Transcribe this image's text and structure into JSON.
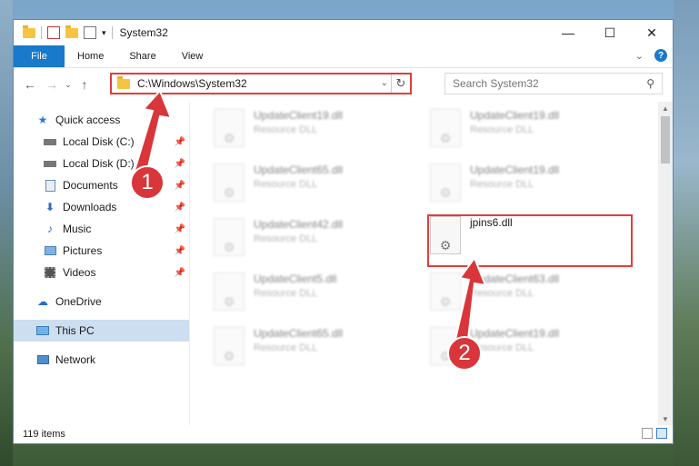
{
  "window": {
    "title": "System32"
  },
  "ribbon": {
    "tabs": [
      "File",
      "Home",
      "Share",
      "View"
    ],
    "help": "?"
  },
  "address": {
    "path": "C:\\Windows\\System32"
  },
  "search": {
    "placeholder": "Search System32"
  },
  "sidebar": {
    "items": [
      {
        "label": "Quick access",
        "icon": "star-icon"
      },
      {
        "label": "Local Disk (C:)",
        "icon": "drive-icon",
        "pinned": true
      },
      {
        "label": "Local Disk (D:)",
        "icon": "drive-icon",
        "pinned": true
      },
      {
        "label": "Documents",
        "icon": "documents-icon",
        "pinned": true
      },
      {
        "label": "Downloads",
        "icon": "download-icon",
        "pinned": true
      },
      {
        "label": "Music",
        "icon": "music-icon",
        "pinned": true
      },
      {
        "label": "Pictures",
        "icon": "pictures-icon",
        "pinned": true
      },
      {
        "label": "Videos",
        "icon": "videos-icon",
        "pinned": true
      },
      {
        "label": "OneDrive",
        "icon": "cloud-icon"
      },
      {
        "label": "This PC",
        "icon": "computer-icon",
        "selected": true
      },
      {
        "label": "Network",
        "icon": "network-icon"
      }
    ]
  },
  "files": [
    {
      "name": "UpdateClient19.dll",
      "type": "Resource DLL"
    },
    {
      "name": "UpdateClient19.dll",
      "type": "Resource DLL"
    },
    {
      "name": "UpdateClient65.dll",
      "type": "Resource DLL"
    },
    {
      "name": "UpdateClient19.dll",
      "type": "Resource DLL"
    },
    {
      "name": "UpdateClient42.dll",
      "type": "Resource DLL"
    },
    {
      "name": "jpins6.dll",
      "type": ""
    },
    {
      "name": "UpdateClient5.dll",
      "type": "Resource DLL"
    },
    {
      "name": "UpdateClient63.dll",
      "type": "Resource DLL"
    },
    {
      "name": "UpdateClient65.dll",
      "type": "Resource DLL"
    },
    {
      "name": "UpdateClient19.dll",
      "type": "Resource DLL"
    }
  ],
  "status": {
    "count": "119 items"
  },
  "callouts": [
    "1",
    "2"
  ],
  "colors": {
    "accent": "#1979ca",
    "highlight": "#e23c3c"
  }
}
